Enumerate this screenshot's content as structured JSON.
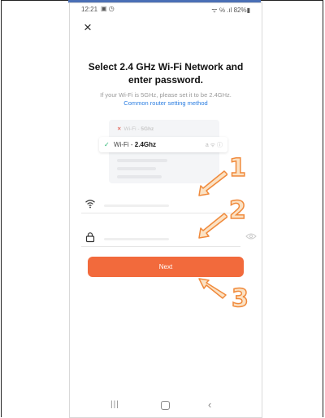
{
  "status_bar": {
    "time": "12:21",
    "left_icons": "▣ ◷",
    "right_text": "ᯤ ℅ .ıl 82%▮"
  },
  "header": {
    "close_label": "×"
  },
  "main": {
    "title_line1": "Select 2.4 GHz Wi-Fi Network and",
    "title_line2": "enter password.",
    "subtitle": "If your Wi-Fi is 5GHz, please set it to be 2.4GHz.",
    "router_link": "Common router setting method"
  },
  "illustration": {
    "wifi_5g_prefix": "Wi-Fi - ",
    "wifi_5g_band": "5Ghz",
    "wifi_24_prefix": "Wi-Fi - ",
    "wifi_24_band": "2.4Ghz",
    "icons_text": "a ᯤ ⓘ"
  },
  "form": {
    "wifi_field_icon": "wifi-icon",
    "password_field_icon": "lock-icon"
  },
  "next_button": {
    "label": "Next"
  },
  "annotations": {
    "step1": "1",
    "step2": "2",
    "step3": "3"
  },
  "colors": {
    "accent": "#f26a3c",
    "link": "#2a7de1",
    "annotation_stroke": "#f08a3c",
    "annotation_fill": "#fbe2c4"
  }
}
